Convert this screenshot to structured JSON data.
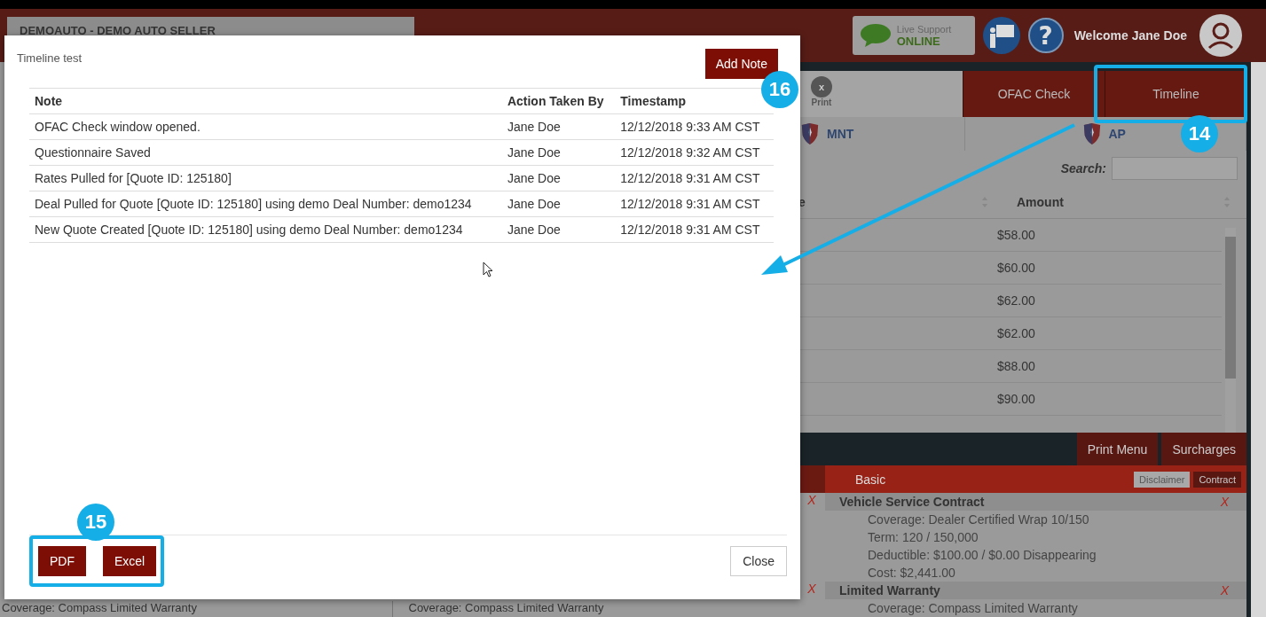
{
  "header": {
    "dealer_select": "DEMOAUTO - DEMO AUTO SELLER",
    "live_support": {
      "label": "Live Support",
      "status": "ONLINE"
    },
    "help": "?",
    "welcome": "Welcome Jane Doe"
  },
  "panel": {
    "print": {
      "close": "x",
      "label": "Print"
    },
    "tabs": [
      {
        "label": "OFAC Check",
        "selected": false
      },
      {
        "label": "Timeline",
        "selected": false
      }
    ],
    "providers": [
      "MNT",
      "AP"
    ],
    "search": {
      "label": "Search:"
    },
    "columns": [
      "e",
      "Amount"
    ],
    "amounts": [
      "$58.00",
      "$60.00",
      "$62.00",
      "$62.00",
      "$88.00",
      "$90.00"
    ],
    "buttons": [
      "Print Menu",
      "Surcharges"
    ],
    "section": {
      "title": "Basic",
      "buttons": [
        "Disclaimer",
        "Contract"
      ]
    },
    "items": [
      {
        "left_mark": "X",
        "title": "Vehicle Service Contract",
        "right_mark": "X",
        "lines": [
          "Coverage: Dealer Certified Wrap 10/150",
          "Term: 120 / 150,000",
          "Deductible: $100.00 / $0.00 Disappearing",
          "Cost: $2,441.00"
        ]
      },
      {
        "left_mark": "X",
        "title": "Limited Warranty",
        "right_mark": "X",
        "lines": [
          "Coverage: Compass Limited Warranty"
        ]
      }
    ]
  },
  "background_texts": [
    "Coverage: Compass Limited Warranty",
    "Coverage: Compass Limited Warranty"
  ],
  "modal": {
    "title": "Timeline test",
    "add_button": "Add Note",
    "columns": [
      "Note",
      "Action Taken By",
      "Timestamp"
    ],
    "rows": [
      [
        "OFAC Check window opened.",
        "Jane Doe",
        "12/12/2018 9:33 AM CST"
      ],
      [
        "Questionnaire Saved",
        "Jane Doe",
        "12/12/2018 9:32 AM CST"
      ],
      [
        "Rates Pulled for [Quote ID: 125180]",
        "Jane Doe",
        "12/12/2018 9:31 AM CST"
      ],
      [
        "Deal Pulled for Quote [Quote ID: 125180] using demo Deal Number: demo1234",
        "Jane Doe",
        "12/12/2018 9:31 AM CST"
      ],
      [
        "New Quote Created [Quote ID: 125180] using demo Deal Number: demo1234",
        "Jane Doe",
        "12/12/2018 9:31 AM CST"
      ]
    ],
    "export_buttons": [
      "PDF",
      "Excel"
    ],
    "close_button": "Close"
  },
  "annotations": [
    {
      "label": "16"
    },
    {
      "label": "14"
    },
    {
      "label": "15"
    }
  ]
}
